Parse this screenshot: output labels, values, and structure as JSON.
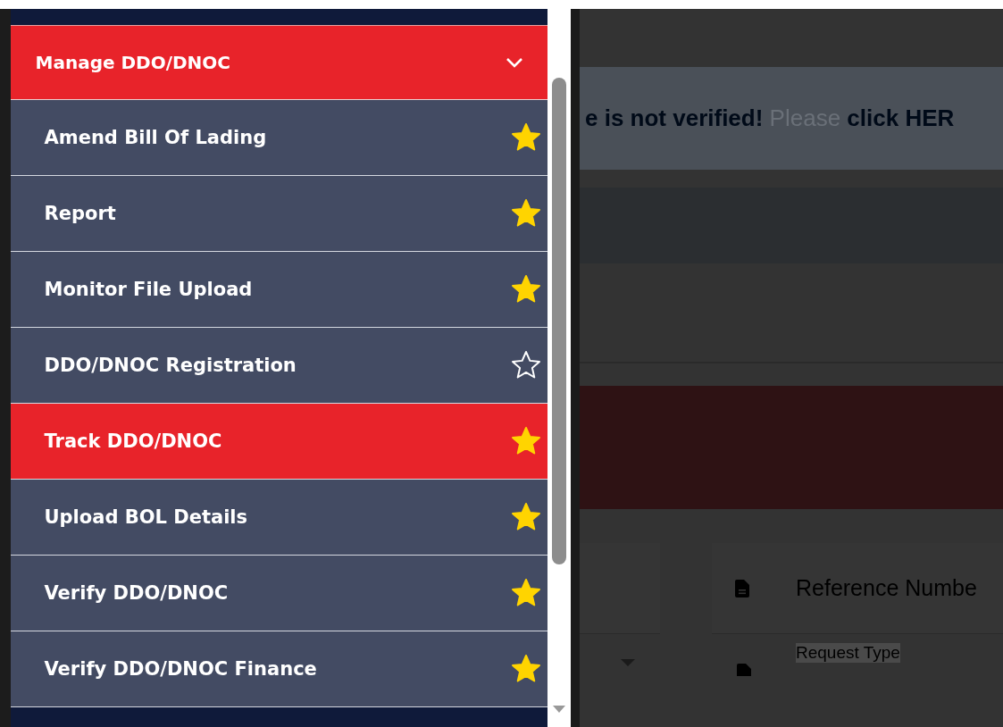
{
  "menu": {
    "header": {
      "label": "Manage DDO/DNOC",
      "expanded": true
    },
    "items": [
      {
        "label": "Amend Bill Of Lading",
        "favorite": true,
        "selected": false
      },
      {
        "label": "Report",
        "favorite": true,
        "selected": false
      },
      {
        "label": "Monitor File Upload",
        "favorite": true,
        "selected": false
      },
      {
        "label": "DDO/DNOC Registration",
        "favorite": false,
        "selected": false
      },
      {
        "label": "Track DDO/DNOC",
        "favorite": true,
        "selected": true
      },
      {
        "label": "Upload BOL Details",
        "favorite": true,
        "selected": false
      },
      {
        "label": "Verify DDO/DNOC",
        "favorite": true,
        "selected": false
      },
      {
        "label": "Verify DDO/DNOC Finance",
        "favorite": true,
        "selected": false
      }
    ]
  },
  "page": {
    "notice": "**e is not verified!** Please **click HER**",
    "reference_field": {
      "placeholder": "Reference Numbe"
    },
    "request_type_label": "Request Type"
  }
}
